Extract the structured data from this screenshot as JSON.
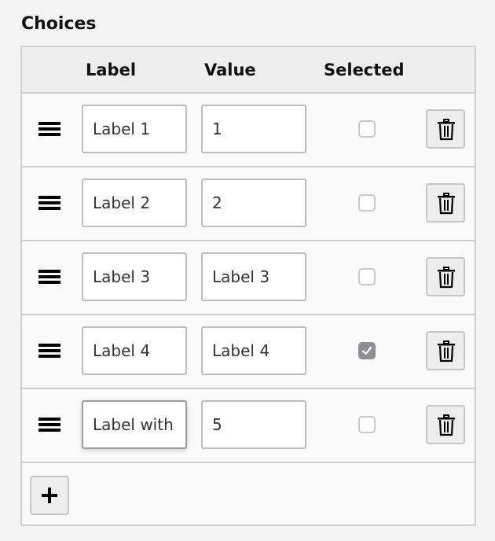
{
  "section_title": "Choices",
  "columns": {
    "label": "Label",
    "value": "Value",
    "selected": "Selected"
  },
  "rows": [
    {
      "label": "Label 1",
      "value": "1",
      "selected": false
    },
    {
      "label": "Label 2",
      "value": "2",
      "selected": false
    },
    {
      "label": "Label 3",
      "value": "Label 3",
      "selected": false
    },
    {
      "label": "Label 4",
      "value": "Label 4",
      "selected": true
    },
    {
      "label": "Label with",
      "value": "5",
      "selected": false,
      "focused": true
    }
  ],
  "icons": {
    "drag": "drag-handle-icon",
    "delete": "trash-icon",
    "add": "plus-icon",
    "check": "checkmark-icon"
  },
  "colors": {
    "checked_fill": "#8e8e93",
    "border": "#cfcfcf",
    "header_bg": "#ededed"
  }
}
